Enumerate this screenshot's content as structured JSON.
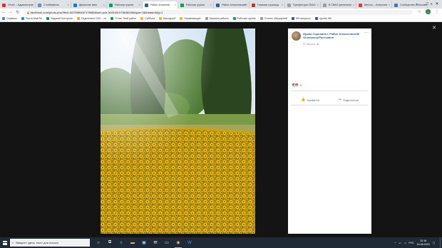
{
  "tabs": [
    {
      "title": "Отчёт – Администрат",
      "color": "#d93025",
      "active": false
    },
    {
      "title": "2 notifications",
      "color": "#6c8ebf",
      "active": false
    },
    {
      "title": "Движение авто",
      "color": "#1a73e8",
      "active": false
    },
    {
      "title": "Рабочая группа",
      "color": "#0f9d58",
      "active": false
    },
    {
      "title": "Район Алексеев",
      "color": "#3b5998",
      "active": true
    },
    {
      "title": "Рабочая группа",
      "color": "#0f9d58",
      "active": false
    },
    {
      "title": "Район Алексеевский",
      "color": "#3b5998",
      "active": false
    },
    {
      "title": "Главная страница",
      "color": "#c0392b",
      "active": false
    },
    {
      "title": "Префектура СВАО",
      "color": "#9e9e9e",
      "active": false
    },
    {
      "title": "В СВАО увеличили",
      "color": "#9e9e9e",
      "active": false
    },
    {
      "title": "Квесты – Алексеев",
      "color": "#e53935",
      "active": false
    },
    {
      "title": "Сообщество Алексеев",
      "color": "#4a76a8",
      "active": false
    }
  ],
  "browser": {
    "url": "facebook.com/photo.php?fbid=3475966497178650&set=pcb.3643181973848028&type=3&theater&ifg=1",
    "profile_letter": "А"
  },
  "bookmarks": [
    {
      "label": "Сервисы",
      "color": "#4285f4"
    },
    {
      "label": "Почта Mail.Ru",
      "color": "#168de2"
    },
    {
      "label": "Заданий Контроль",
      "color": "#0f9d58"
    },
    {
      "label": "Подготовка САО – по",
      "color": "#f4b400"
    },
    {
      "label": "Отчет Твой район",
      "color": "#0f9d58"
    },
    {
      "label": "Суббота",
      "color": "#fbbc04"
    },
    {
      "label": "Выходной",
      "color": "#fbbc04"
    },
    {
      "label": "Управляющие",
      "color": "#fbbc04"
    },
    {
      "label": "Машина района",
      "color": "#9e9e9e"
    },
    {
      "label": "Рабочая группа",
      "color": "#0f9d58"
    },
    {
      "label": "Отчеты обращений",
      "color": "#9e9e9e"
    },
    {
      "label": "ЖК вопросы",
      "color": "#3f51b5"
    },
    {
      "label": "группы ЖК",
      "color": "#3f51b5"
    }
  ],
  "post": {
    "author": "Ирина Сорокина",
    "separator": "▸",
    "group": "Район Алексеевский/Останкино/Ростокино",
    "date": "22 августа",
    "reaction_count": "5",
    "like_label": "Нравится",
    "share_label": "Поделиться"
  },
  "taskbar": {
    "search_placeholder": "Введите здесь текст для поиска",
    "lang": "РУС",
    "time": "12:16",
    "date": "24.08.2020"
  }
}
